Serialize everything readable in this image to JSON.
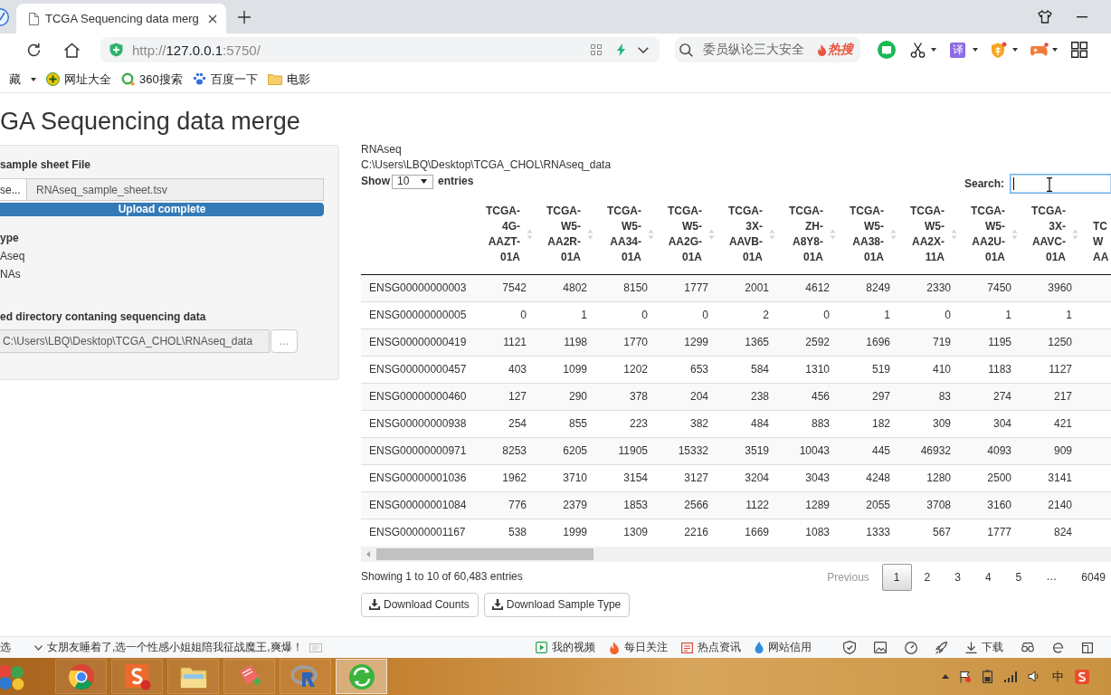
{
  "browser": {
    "tab": {
      "title": "TCGA Sequencing data merg",
      "selected": true
    },
    "address": {
      "scheme": "http://",
      "host": "127.0.0.1",
      "port_path": ":5750/"
    },
    "search": {
      "placeholder": "委员纵论三大安全",
      "hot_label": "热搜"
    },
    "toolbar": {
      "translate_label": "译"
    },
    "bookmarks": [
      {
        "label": "藏",
        "kind": "menu"
      },
      {
        "label": "网址大全",
        "kind": "site"
      },
      {
        "label": "360搜索",
        "kind": "site"
      },
      {
        "label": "百度一下",
        "kind": "site"
      },
      {
        "label": "电影",
        "kind": "folder"
      }
    ]
  },
  "page": {
    "title": "GA Sequencing data merge"
  },
  "sidebar": {
    "file_input": {
      "label": "sample sheet File",
      "button": "se...",
      "value": "RNAseq_sample_sheet.tsv",
      "progress": {
        "level": 1,
        "text": "Upload complete"
      }
    },
    "data_type": {
      "label": "ype",
      "options": [
        {
          "label": "Aseq"
        },
        {
          "label": "NAs"
        }
      ]
    },
    "directory": {
      "label": "ed directory contaning sequencing data",
      "value": "C:\\Users\\LBQ\\Desktop\\TCGA_CHOL\\RNAseq_data",
      "button": "..."
    }
  },
  "main": {
    "data_type": "RNAseq",
    "path": "C:\\Users\\LBQ\\Desktop\\TCGA_CHOL\\RNAseq_data",
    "length": {
      "before": "Show",
      "value": "10",
      "after": "entries"
    },
    "search": {
      "label": "Search:",
      "focused": true
    }
  },
  "table": {
    "columns": [
      {
        "lines": [
          "TCGA-",
          "4G-",
          "AAZT-",
          "01A"
        ],
        "partial": false
      },
      {
        "lines": [
          "TCGA-",
          "W5-",
          "AA2R-",
          "01A"
        ],
        "partial": false
      },
      {
        "lines": [
          "TCGA-",
          "W5-",
          "AA34-",
          "01A"
        ],
        "partial": false
      },
      {
        "lines": [
          "TCGA-",
          "W5-",
          "AA2G-",
          "01A"
        ],
        "partial": false
      },
      {
        "lines": [
          "TCGA-",
          "3X-",
          "AAVB-",
          "01A"
        ],
        "partial": false
      },
      {
        "lines": [
          "TCGA-",
          "ZH-",
          "A8Y8-",
          "01A"
        ],
        "partial": false
      },
      {
        "lines": [
          "TCGA-",
          "W5-",
          "AA38-",
          "01A"
        ],
        "partial": false
      },
      {
        "lines": [
          "TCGA-",
          "W5-",
          "AA2X-",
          "11A"
        ],
        "partial": false
      },
      {
        "lines": [
          "TCGA-",
          "W5-",
          "AA2U-",
          "01A"
        ],
        "partial": false
      },
      {
        "lines": [
          "TCGA-",
          "3X-",
          "AAVC-",
          "01A"
        ],
        "partial": false
      },
      {
        "lines": [
          "TC",
          "W",
          "AA"
        ],
        "partial": true
      }
    ],
    "rows": [
      {
        "gene": "ENSG00000000003",
        "values": [
          "7542",
          "4802",
          "8150",
          "1777",
          "2001",
          "4612",
          "8249",
          "2330",
          "7450",
          "3960"
        ]
      },
      {
        "gene": "ENSG00000000005",
        "values": [
          "0",
          "1",
          "0",
          "0",
          "2",
          "0",
          "1",
          "0",
          "1",
          "1"
        ]
      },
      {
        "gene": "ENSG00000000419",
        "values": [
          "1121",
          "1198",
          "1770",
          "1299",
          "1365",
          "2592",
          "1696",
          "719",
          "1195",
          "1250"
        ]
      },
      {
        "gene": "ENSG00000000457",
        "values": [
          "403",
          "1099",
          "1202",
          "653",
          "584",
          "1310",
          "519",
          "410",
          "1183",
          "1127"
        ]
      },
      {
        "gene": "ENSG00000000460",
        "values": [
          "127",
          "290",
          "378",
          "204",
          "238",
          "456",
          "297",
          "83",
          "274",
          "217"
        ]
      },
      {
        "gene": "ENSG00000000938",
        "values": [
          "254",
          "855",
          "223",
          "382",
          "484",
          "883",
          "182",
          "309",
          "304",
          "421"
        ]
      },
      {
        "gene": "ENSG00000000971",
        "values": [
          "8253",
          "6205",
          "11905",
          "15332",
          "3519",
          "10043",
          "445",
          "46932",
          "4093",
          "909"
        ]
      },
      {
        "gene": "ENSG00000001036",
        "values": [
          "1962",
          "3710",
          "3154",
          "3127",
          "3204",
          "3043",
          "4248",
          "1280",
          "2500",
          "3141"
        ]
      },
      {
        "gene": "ENSG00000001084",
        "values": [
          "776",
          "2379",
          "1853",
          "2566",
          "1122",
          "1289",
          "2055",
          "3708",
          "3160",
          "2140"
        ]
      },
      {
        "gene": "ENSG00000001167",
        "values": [
          "538",
          "1999",
          "1309",
          "2216",
          "1669",
          "1083",
          "1333",
          "567",
          "1777",
          "824"
        ]
      }
    ]
  },
  "pagination": {
    "info": "Showing 1 to 10 of 60,483 entries",
    "items": [
      {
        "label": "Previous",
        "kind": "previous",
        "selected": false,
        "disabled": true
      },
      {
        "label": "1",
        "kind": "page",
        "selected": true,
        "disabled": false
      },
      {
        "label": "2",
        "kind": "page",
        "selected": false,
        "disabled": false
      },
      {
        "label": "3",
        "kind": "page",
        "selected": false,
        "disabled": false
      },
      {
        "label": "4",
        "kind": "page",
        "selected": false,
        "disabled": false
      },
      {
        "label": "5",
        "kind": "page",
        "selected": false,
        "disabled": false
      },
      {
        "label": "…",
        "kind": "ellipsis",
        "selected": false,
        "disabled": false
      },
      {
        "label": "6049",
        "kind": "page",
        "selected": false,
        "disabled": false
      }
    ]
  },
  "download_buttons": [
    {
      "label": "Download Counts"
    },
    {
      "label": "Download Sample Type"
    }
  ],
  "status_bar": {
    "left_text": "选",
    "news": "女朋友睡着了,选一个性感小姐姐陪我征战魔王,爽爆！",
    "links": [
      {
        "label": "我的视频"
      },
      {
        "label": "每日关注"
      },
      {
        "label": "热点资讯"
      },
      {
        "label": "网站信用"
      }
    ],
    "download_label": "下载"
  },
  "taskbar": {
    "apps": [
      {
        "selected": false
      },
      {
        "selected": false
      },
      {
        "selected": false
      },
      {
        "selected": false
      },
      {
        "selected": false
      },
      {
        "selected": true
      }
    ],
    "ime": "中"
  }
}
